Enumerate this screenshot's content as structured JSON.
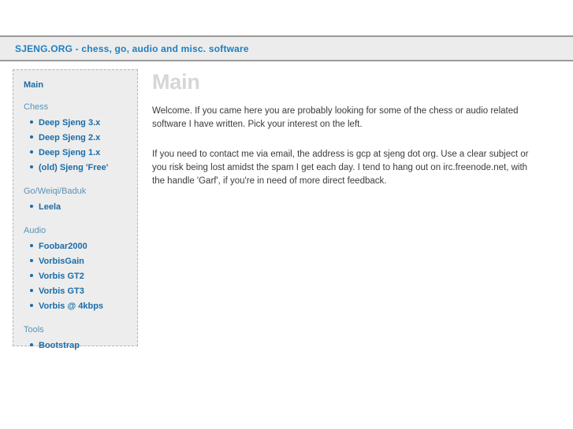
{
  "header": {
    "title": "SJENG.ORG - chess, go, audio and misc. software",
    "accent_color": "#1e7fc2",
    "background_color": "#ececec"
  },
  "sidebar": {
    "top_link": "Main",
    "link_color": "#1a6da8",
    "label_color": "#5b93b8",
    "background_color": "#ededed",
    "groups": [
      {
        "label": "Chess",
        "items": [
          {
            "label": "Deep Sjeng 3.x"
          },
          {
            "label": "Deep Sjeng 2.x"
          },
          {
            "label": "Deep Sjeng 1.x"
          },
          {
            "label": "(old) Sjeng 'Free'"
          }
        ]
      },
      {
        "label": "Go/Weiqi/Baduk",
        "items": [
          {
            "label": "Leela"
          }
        ]
      },
      {
        "label": "Audio",
        "items": [
          {
            "label": "Foobar2000"
          },
          {
            "label": "VorbisGain"
          },
          {
            "label": "Vorbis GT2"
          },
          {
            "label": "Vorbis GT3"
          },
          {
            "label": "Vorbis @ 4kbps"
          }
        ]
      },
      {
        "label": "Tools",
        "items": [
          {
            "label": "Bootstrap"
          }
        ]
      }
    ]
  },
  "main": {
    "heading": "Main",
    "heading_color": "#d6d6d6",
    "paragraphs": [
      "Welcome. If you came here you are probably looking for some of the chess or audio related software I have written. Pick your interest on the left.",
      "If you need to contact me via email, the address is gcp at sjeng dot org. Use a clear subject or you risk being lost amidst the spam I get each day. I tend to hang out on irc.freenode.net, with the handle 'Garf', if you're in need of more direct feedback."
    ]
  }
}
